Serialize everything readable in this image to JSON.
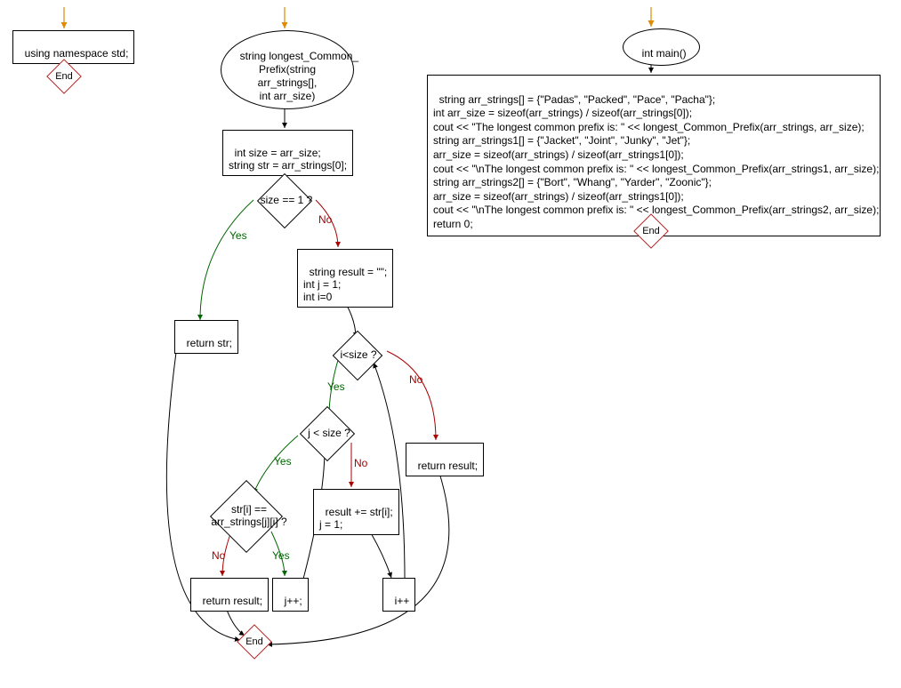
{
  "entry_arrow_color": "#e08a00",
  "yes_color": "#006600",
  "no_color": "#aa0000",
  "flow1": {
    "stmt": "using namespace std;",
    "end": "End"
  },
  "flow2": {
    "func_sig": "string longest_Common_\nPrefix(string\narr_strings[],\nint arr_size)",
    "init": "int size = arr_size;\nstring str = arr_strings[0];",
    "cond_size1": "size == 1 ?",
    "ret_str": "return str;",
    "init2": "string result = \"\";\nint j = 1;\nint i=0",
    "cond_isize": "i<size ?",
    "cond_jsize": "j < size ?",
    "cond_chareq": "str[i] ==\narr_strings[j][i] ?",
    "ret_result_inner": "return result;",
    "jpp": "j++;",
    "append": "result += str[i];\nj = 1;",
    "ipp": "i++",
    "ret_result_outer": "return result;",
    "end": "End",
    "yes": "Yes",
    "no": "No"
  },
  "flow3": {
    "func_sig": "int main()",
    "body": "string arr_strings[] = {\"Padas\", \"Packed\", \"Pace\", \"Pacha\"};\nint arr_size = sizeof(arr_strings) / sizeof(arr_strings[0]);\ncout << \"The longest common prefix is: \" << longest_Common_Prefix(arr_strings, arr_size);\nstring arr_strings1[] = {\"Jacket\", \"Joint\", \"Junky\", \"Jet\"};\narr_size = sizeof(arr_strings) / sizeof(arr_strings1[0]);\ncout << \"\\nThe longest common prefix is: \" << longest_Common_Prefix(arr_strings1, arr_size);\nstring arr_strings2[] = {\"Bort\", \"Whang\", \"Yarder\", \"Zoonic\"};\narr_size = sizeof(arr_strings) / sizeof(arr_strings1[0]);\ncout << \"\\nThe longest common prefix is: \" << longest_Common_Prefix(arr_strings2, arr_size);\nreturn 0;",
    "end": "End"
  },
  "chart_data": {
    "type": "diagram",
    "diagram_kind": "flowchart",
    "subgraphs": [
      {
        "id": "ns",
        "nodes": [
          {
            "id": "ns_entry",
            "type": "entry"
          },
          {
            "id": "ns_stmt",
            "type": "process",
            "text": "using namespace std;"
          },
          {
            "id": "ns_end",
            "type": "terminator",
            "text": "End"
          }
        ],
        "edges": [
          {
            "from": "ns_entry",
            "to": "ns_stmt"
          },
          {
            "from": "ns_stmt",
            "to": "ns_end"
          }
        ]
      },
      {
        "id": "lcp",
        "nodes": [
          {
            "id": "lcp_entry",
            "type": "entry"
          },
          {
            "id": "lcp_sig",
            "type": "start-oval",
            "text": "string longest_Common_Prefix(string arr_strings[], int arr_size)"
          },
          {
            "id": "lcp_init",
            "type": "process",
            "text": "int size = arr_size; string str = arr_strings[0];"
          },
          {
            "id": "lcp_size1",
            "type": "decision",
            "text": "size == 1 ?"
          },
          {
            "id": "lcp_retstr",
            "type": "process",
            "text": "return str;"
          },
          {
            "id": "lcp_init2",
            "type": "process",
            "text": "string result = \"\"; int j = 1; int i=0"
          },
          {
            "id": "lcp_isize",
            "type": "decision",
            "text": "i<size ?"
          },
          {
            "id": "lcp_jsize",
            "type": "decision",
            "text": "j < size ?"
          },
          {
            "id": "lcp_chareq",
            "type": "decision",
            "text": "str[i] == arr_strings[j][i] ?"
          },
          {
            "id": "lcp_retres_in",
            "type": "process",
            "text": "return result;"
          },
          {
            "id": "lcp_jpp",
            "type": "process",
            "text": "j++;"
          },
          {
            "id": "lcp_append",
            "type": "process",
            "text": "result += str[i]; j = 1;"
          },
          {
            "id": "lcp_ipp",
            "type": "process",
            "text": "i++"
          },
          {
            "id": "lcp_retres_out",
            "type": "process",
            "text": "return result;"
          },
          {
            "id": "lcp_end",
            "type": "terminator",
            "text": "End"
          }
        ],
        "edges": [
          {
            "from": "lcp_entry",
            "to": "lcp_sig"
          },
          {
            "from": "lcp_sig",
            "to": "lcp_init"
          },
          {
            "from": "lcp_init",
            "to": "lcp_size1"
          },
          {
            "from": "lcp_size1",
            "to": "lcp_retstr",
            "label": "Yes"
          },
          {
            "from": "lcp_size1",
            "to": "lcp_init2",
            "label": "No"
          },
          {
            "from": "lcp_init2",
            "to": "lcp_isize"
          },
          {
            "from": "lcp_isize",
            "to": "lcp_jsize",
            "label": "Yes"
          },
          {
            "from": "lcp_isize",
            "to": "lcp_retres_out",
            "label": "No"
          },
          {
            "from": "lcp_jsize",
            "to": "lcp_chareq",
            "label": "Yes"
          },
          {
            "from": "lcp_jsize",
            "to": "lcp_append",
            "label": "No"
          },
          {
            "from": "lcp_chareq",
            "to": "lcp_retres_in",
            "label": "No"
          },
          {
            "from": "lcp_chareq",
            "to": "lcp_jpp",
            "label": "Yes"
          },
          {
            "from": "lcp_jpp",
            "to": "lcp_jsize"
          },
          {
            "from": "lcp_append",
            "to": "lcp_ipp"
          },
          {
            "from": "lcp_ipp",
            "to": "lcp_isize"
          },
          {
            "from": "lcp_retstr",
            "to": "lcp_end"
          },
          {
            "from": "lcp_retres_in",
            "to": "lcp_end"
          },
          {
            "from": "lcp_retres_out",
            "to": "lcp_end"
          }
        ]
      },
      {
        "id": "main",
        "nodes": [
          {
            "id": "m_entry",
            "type": "entry"
          },
          {
            "id": "m_sig",
            "type": "start-oval",
            "text": "int main()"
          },
          {
            "id": "m_body",
            "type": "process",
            "text": "string arr_strings[] = {\"Padas\", \"Packed\", \"Pace\", \"Pacha\"}; int arr_size = sizeof(arr_strings) / sizeof(arr_strings[0]); cout << \"The longest common prefix is: \" << longest_Common_Prefix(arr_strings, arr_size); string arr_strings1[] = {\"Jacket\", \"Joint\", \"Junky\", \"Jet\"}; arr_size = sizeof(arr_strings) / sizeof(arr_strings1[0]); cout << \"\\nThe longest common prefix is: \" << longest_Common_Prefix(arr_strings1, arr_size); string arr_strings2[] = {\"Bort\", \"Whang\", \"Yarder\", \"Zoonic\"}; arr_size = sizeof(arr_strings) / sizeof(arr_strings1[0]); cout << \"\\nThe longest common prefix is: \" << longest_Common_Prefix(arr_strings2, arr_size); return 0;"
          },
          {
            "id": "m_end",
            "type": "terminator",
            "text": "End"
          }
        ],
        "edges": [
          {
            "from": "m_entry",
            "to": "m_sig"
          },
          {
            "from": "m_sig",
            "to": "m_body"
          },
          {
            "from": "m_body",
            "to": "m_end"
          }
        ]
      }
    ]
  }
}
